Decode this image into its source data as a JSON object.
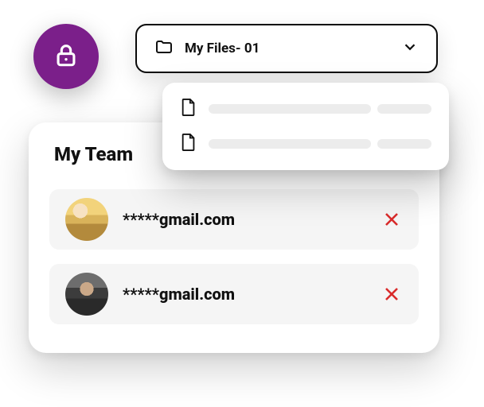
{
  "lock_badge": {
    "color": "#7b1f8a",
    "icon": "lock"
  },
  "folder_select": {
    "label": "My Files- 01",
    "icon": "folder",
    "chevron": "down"
  },
  "file_popover": {
    "items": [
      {
        "icon": "file",
        "placeholder": true
      },
      {
        "icon": "file",
        "placeholder": true
      }
    ]
  },
  "team_card": {
    "title": "My Team",
    "members": [
      {
        "email": "*****gmail.com",
        "remove_action": "remove"
      },
      {
        "email": "*****gmail.com",
        "remove_action": "remove"
      }
    ]
  },
  "colors": {
    "accent": "#7b1f8a",
    "danger": "#d92b2b",
    "card": "#ffffff",
    "row": "#f5f5f5"
  }
}
